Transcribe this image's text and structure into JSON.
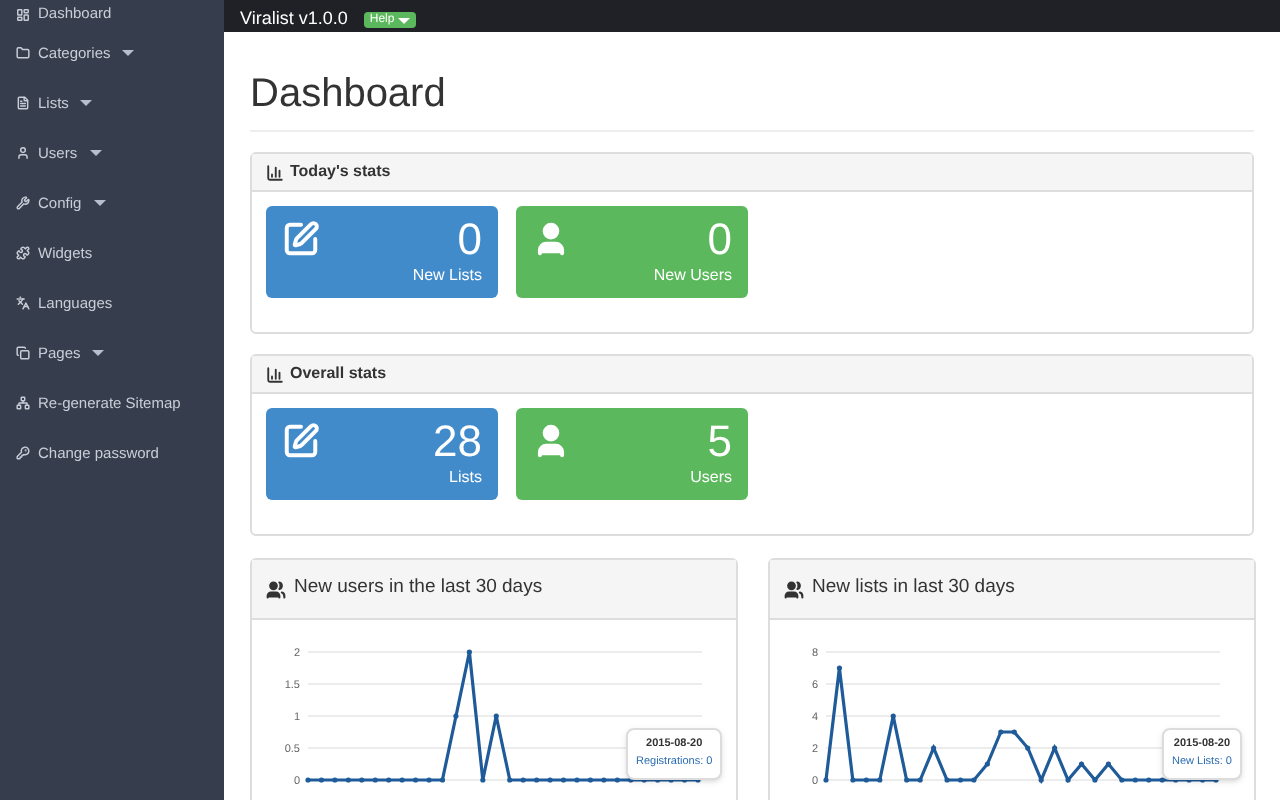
{
  "sidebar": {
    "items": [
      {
        "label": "Dashboard",
        "has_submenu": false
      },
      {
        "label": "Categories",
        "has_submenu": true
      },
      {
        "label": "Lists",
        "has_submenu": true
      },
      {
        "label": "Users",
        "has_submenu": true
      },
      {
        "label": "Config",
        "has_submenu": true
      },
      {
        "label": "Widgets",
        "has_submenu": false
      },
      {
        "label": "Languages",
        "has_submenu": false
      },
      {
        "label": "Pages",
        "has_submenu": true
      },
      {
        "label": "Re-generate Sitemap",
        "has_submenu": false
      },
      {
        "label": "Change password",
        "has_submenu": false
      }
    ]
  },
  "topbar": {
    "brand": "Viralist v1.0.0",
    "help_button": "Help"
  },
  "page_title": "Dashboard",
  "stat_panels": [
    {
      "title": "Today's stats",
      "tiles": [
        {
          "kind": "lists",
          "value": "0",
          "label": "New Lists"
        },
        {
          "kind": "users",
          "value": "0",
          "label": "New Users"
        }
      ]
    },
    {
      "title": "Overall stats",
      "tiles": [
        {
          "kind": "lists",
          "value": "28",
          "label": "Lists"
        },
        {
          "kind": "users",
          "value": "5",
          "label": "Users"
        }
      ]
    }
  ],
  "chart_panels": [
    {
      "title": "New users in the last 30 days",
      "tooltip": {
        "date": "2015-08-20",
        "text": "Registrations: 0"
      },
      "chart_data": {
        "type": "line",
        "grid": true,
        "ylim": [
          0,
          2
        ],
        "yticks": [
          0,
          0.5,
          1,
          1.5,
          2
        ],
        "series": [
          {
            "color": "#1f5b99",
            "values": [
              0,
              0,
              0,
              0,
              0,
              0,
              0,
              0,
              0,
              0,
              0,
              1,
              2,
              0,
              1,
              0,
              0,
              0,
              0,
              0,
              0,
              0,
              0,
              0,
              0,
              0,
              0,
              0,
              0,
              0
            ]
          }
        ]
      }
    },
    {
      "title": "New lists in last 30 days",
      "tooltip": {
        "date": "2015-08-20",
        "text": "New Lists: 0"
      },
      "chart_data": {
        "type": "line",
        "grid": true,
        "ylim": [
          0,
          8
        ],
        "yticks": [
          0,
          2,
          4,
          6,
          8
        ],
        "series": [
          {
            "color": "#1f5b99",
            "values": [
              0,
              7,
              0,
              0,
              0,
              4,
              0,
              0,
              2,
              0,
              0,
              0,
              1,
              3,
              3,
              2,
              0,
              2,
              0,
              1,
              0,
              1,
              0,
              0,
              0,
              0,
              0,
              0,
              0,
              0
            ]
          }
        ]
      }
    }
  ]
}
